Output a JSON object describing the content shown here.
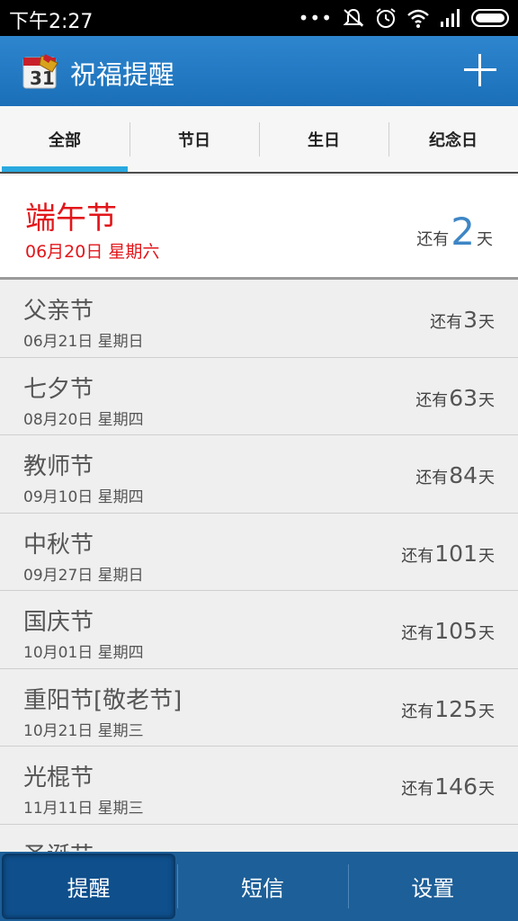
{
  "status_bar": {
    "time": "下午2:27",
    "icons": [
      "more-dots-icon",
      "mute-icon",
      "alarm-icon",
      "wifi-icon",
      "signal-icon",
      "battery-icon"
    ]
  },
  "app_bar": {
    "title": "祝福提醒",
    "logo_icon": "calendar-31-icon",
    "action_icon": "plus-icon"
  },
  "tabs": [
    {
      "label": "全部",
      "active": true
    },
    {
      "label": "节日",
      "active": false
    },
    {
      "label": "生日",
      "active": false
    },
    {
      "label": "纪念日",
      "active": false
    }
  ],
  "highlight": {
    "name": "端午节",
    "date": "06月20日 星期六",
    "prefix": "还有",
    "days": "2",
    "suffix": "天"
  },
  "reminders": [
    {
      "name": "父亲节",
      "date": "06月21日 星期日",
      "prefix": "还有",
      "days": "3",
      "suffix": "天"
    },
    {
      "name": "七夕节",
      "date": "08月20日 星期四",
      "prefix": "还有",
      "days": "63",
      "suffix": "天"
    },
    {
      "name": "教师节",
      "date": "09月10日 星期四",
      "prefix": "还有",
      "days": "84",
      "suffix": "天"
    },
    {
      "name": "中秋节",
      "date": "09月27日 星期日",
      "prefix": "还有",
      "days": "101",
      "suffix": "天"
    },
    {
      "name": "国庆节",
      "date": "10月01日 星期四",
      "prefix": "还有",
      "days": "105",
      "suffix": "天"
    },
    {
      "name": "重阳节[敬老节]",
      "date": "10月21日 星期三",
      "prefix": "还有",
      "days": "125",
      "suffix": "天"
    },
    {
      "name": "光棍节",
      "date": "11月11日 星期三",
      "prefix": "还有",
      "days": "146",
      "suffix": "天"
    },
    {
      "name": "圣诞节",
      "date": "",
      "prefix": "",
      "days": "",
      "suffix": ""
    }
  ],
  "bottom_nav": [
    {
      "label": "提醒",
      "active": true
    },
    {
      "label": "短信",
      "active": false
    },
    {
      "label": "设置",
      "active": false
    }
  ],
  "colors": {
    "accent": "#29a9e0",
    "app_bar": "#1f75bf",
    "highlight_red": "#e2161a",
    "count_blue": "#3d86c6",
    "bottom_bar": "#1d5f98"
  }
}
